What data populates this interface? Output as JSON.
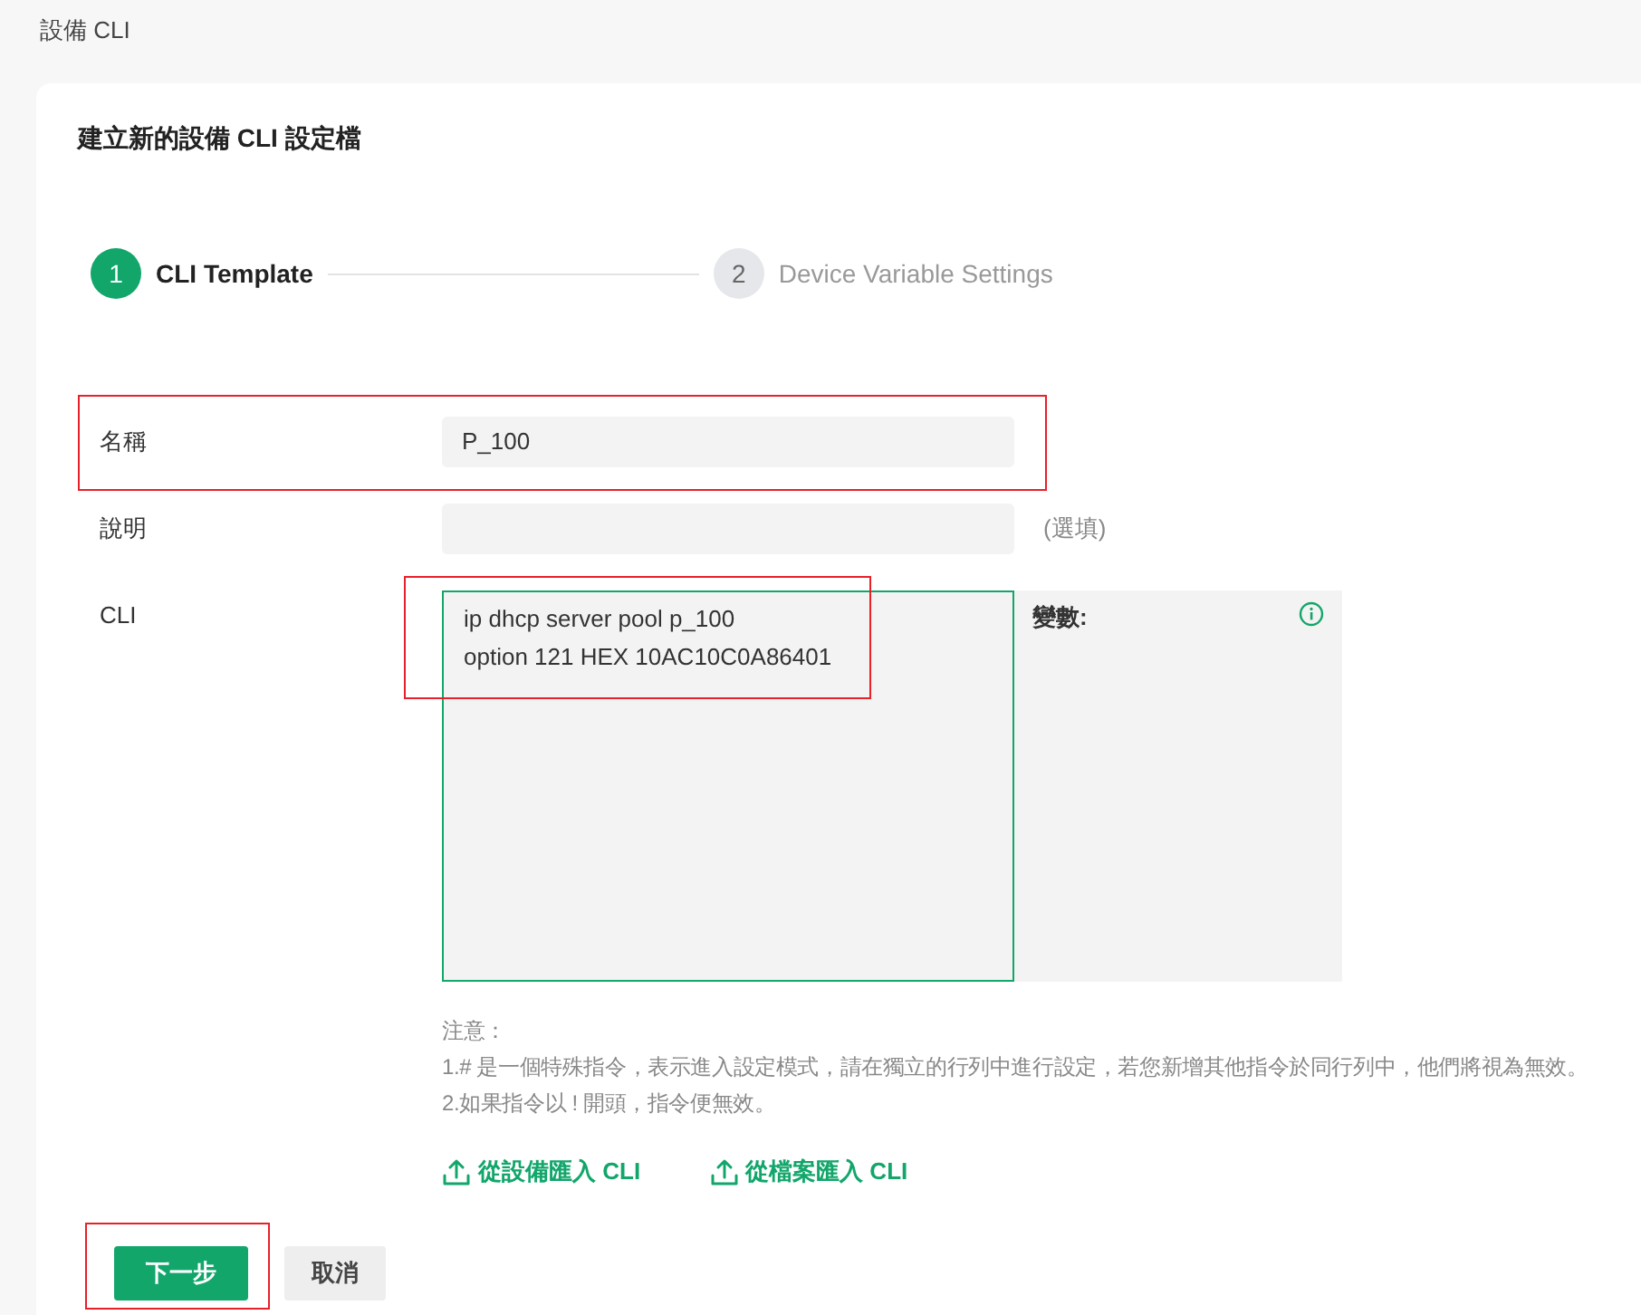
{
  "page_title": "設備 CLI",
  "card_title": "建立新的設備 CLI 設定檔",
  "steps": [
    {
      "number": "1",
      "label": "CLI Template",
      "selected": true
    },
    {
      "number": "2",
      "label": "Device Variable Settings",
      "selected": false
    }
  ],
  "fields": [
    {
      "kind": "text",
      "label": "名稱",
      "value": "P_100",
      "highlighted": true
    },
    {
      "kind": "text",
      "label": "說明",
      "hint": "(選填)",
      "highlighted": false
    },
    {
      "kind": "cli",
      "label": "CLI",
      "lines": [
        "ip dhcp server pool p_100",
        "option 121 HEX 10AC10C0A86401"
      ],
      "variables_label": "變數:",
      "highlighted": true
    }
  ],
  "notes": {
    "heading": "注意：",
    "items": [
      "1.# 是一個特殊指令，表示進入設定模式，請在獨立的行列中進行設定，若您新增其他指令於同行列中，他們將視為無效。",
      "2.如果指令以 ! 開頭，指令便無效。"
    ]
  },
  "import_links": [
    "從設備匯入 CLI",
    "從檔案匯入 CLI"
  ],
  "buttons": [
    {
      "kind": "primary",
      "label": "下一步",
      "highlighted": true
    },
    {
      "kind": "secondary",
      "label": "取消",
      "highlighted": false
    }
  ]
}
